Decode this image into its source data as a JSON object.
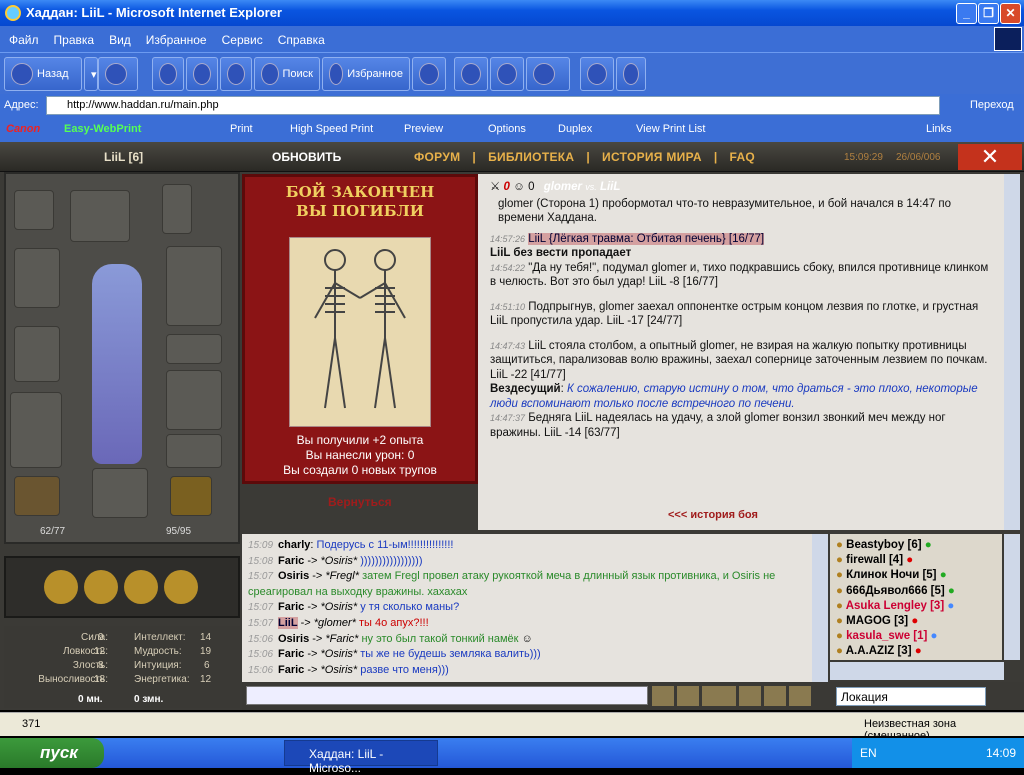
{
  "window": {
    "title": "Хаддан: LiiL - Microsoft Internet Explorer"
  },
  "menu": [
    "Файл",
    "Правка",
    "Вид",
    "Избранное",
    "Сервис",
    "Справка"
  ],
  "toolbar": {
    "back": "Назад",
    "search": "Поиск",
    "favorites": "Избранное"
  },
  "address": {
    "label": "Адрес:",
    "url": "http://www.haddan.ru/main.php",
    "go": "Переход"
  },
  "printbar": {
    "brand": "Canon",
    "product": "Easy-WebPrint",
    "print": "Print",
    "hsprint": "High Speed Print",
    "preview": "Preview",
    "options": "Options",
    "duplex": "Duplex",
    "viewlist": "View Print List",
    "links": "Links"
  },
  "game": {
    "player": "LiiL [6]",
    "refresh": "ОБНОВИТЬ",
    "nav": [
      "ФОРУМ",
      "БИБЛИОТЕКА",
      "ИСТОРИЯ МИРА",
      "FAQ"
    ],
    "time": "15:09:29",
    "date": "26/06/006",
    "hp": "62/77",
    "mp": "95/95",
    "stats": {
      "left": [
        [
          "Сила:",
          "9"
        ],
        [
          "Ловкость:",
          "12"
        ],
        [
          "Злость:",
          "8"
        ],
        [
          "Выносливость:",
          "18"
        ]
      ],
      "right": [
        [
          "Интеллект:",
          "14"
        ],
        [
          "Мудрость:",
          "19"
        ],
        [
          "Интуиция:",
          "6"
        ],
        [
          "Энергетика:",
          "12"
        ]
      ]
    },
    "money": {
      "mn": "0 мн.",
      "zmn": "0 змн."
    },
    "card": {
      "line1": "БОЙ ЗАКОНЧЕН",
      "line2": "ВЫ ПОГИБЛИ",
      "exp": "Вы получили +2 опыта",
      "dmg": "Вы нанесли урон: 0",
      "corpses": "Вы создали 0 новых трупов",
      "back": "Вернуться"
    },
    "battle_header": {
      "zero1": "0",
      "zero2": "0",
      "p1": "glomer",
      "vs": "vs.",
      "p2": "LiiL"
    },
    "history_link": "<<< история боя",
    "log": [
      {
        "type": "start",
        "text": "glomer (Сторона 1) пробормотал что-то невразумительное, и бой начался в 14:47 по времени Хаддана."
      },
      {
        "t": "14:57:26",
        "text": "LiiL {Лёгкая травма: Отбитая печень} [16/77]"
      },
      {
        "type": "missing",
        "text": "LiiL без вести пропадает"
      },
      {
        "t": "14:54:22",
        "text": "\"Да ну тебя!\", подумал glomer и, тихо подкравшись сбоку, впился противнице клинком в челюсть. Вот это был удар! LiiL -8 [16/77]"
      },
      {
        "t": "14:51:10",
        "text": "Подпрыгнув, glomer заехал оппонентке острым концом лезвия по глотке, и грустная LiiL пропустила удар. LiiL -17 [24/77]"
      },
      {
        "t": "14:47:43",
        "text": "LiiL стояла столбом, а опытный glomer, не взирая на жалкую попытку противницы защититься, парализовав волю вражины, заехал сопернице заточенным лезвием по почкам. LiiL -22 [41/77]"
      },
      {
        "type": "god",
        "who": "Вездесущий",
        "text": "К сожалению, старую истину о том, что драться - это плохо, некоторые люди вспоминают только после встречного по печени."
      },
      {
        "t": "14:47:37",
        "text": "Бедняга LiiL надеялась на удачу, а злой glomer вонзил звонкий меч между ног вражины. LiiL -14 [63/77]"
      }
    ],
    "chat": [
      {
        "t": "15:09",
        "from": "charly",
        "to": "",
        "msg": "Подерусь с 11-ым!!!!!!!!!!!!!!!"
      },
      {
        "t": "15:08",
        "from": "Faric",
        "to": "*Osiris*",
        "msg": ")))))))))))))))))"
      },
      {
        "t": "15:07",
        "from": "Osiris",
        "to": "*Fregl*",
        "msg": "затем Fregl провел атаку рукояткой меча в длинный язык противника, и Osiris не среагировал на выходку вражины. хахахах"
      },
      {
        "t": "15:07",
        "from": "Faric",
        "to": "*Osiris*",
        "msg": "у тя сколько маны?"
      },
      {
        "t": "15:07",
        "from": "LiiL",
        "to": "*glomer*",
        "msg": "ты 4о апух?!!!"
      },
      {
        "t": "15:06",
        "from": "Osiris",
        "to": "*Faric*",
        "msg": "ну это был такой тонкий намёк"
      },
      {
        "t": "15:06",
        "from": "Faric",
        "to": "*Osiris*",
        "msg": "ты же не будешь земляка валить)))"
      },
      {
        "t": "15:06",
        "from": "Faric",
        "to": "*Osiris*",
        "msg": "разве что меня)))"
      }
    ],
    "users": [
      {
        "n": "Beastyboy [6]",
        "c": "#111",
        "mark": "green"
      },
      {
        "n": "firewall [4]",
        "c": "#111",
        "mark": "red"
      },
      {
        "n": "Клинок Ночи [5]",
        "c": "#111",
        "mark": "green"
      },
      {
        "n": "666Дьявол666 [5]",
        "c": "#111",
        "mark": "green"
      },
      {
        "n": "Asuka Lengley [3]",
        "c": "#c03",
        "mark": "blue"
      },
      {
        "n": "MAGOG [3]",
        "c": "#111",
        "mark": "red"
      },
      {
        "n": "kasula_swe [1]",
        "c": "#c03",
        "mark": "blue"
      },
      {
        "n": "A.A.AZIZ [3]",
        "c": "#111",
        "mark": "red"
      }
    ],
    "location": "Локация"
  },
  "status": {
    "count": "371",
    "zone": "Неизвестная зона (смешанное)"
  },
  "taskbar": {
    "start": "пуск",
    "task": "Хаддан: LiiL - Microso...",
    "lang": "EN",
    "clock": "14:09"
  },
  "colors": {
    "accent": "#e8b14a",
    "ie_blue": "#3b6ed6",
    "card_red": "#8b1415"
  }
}
